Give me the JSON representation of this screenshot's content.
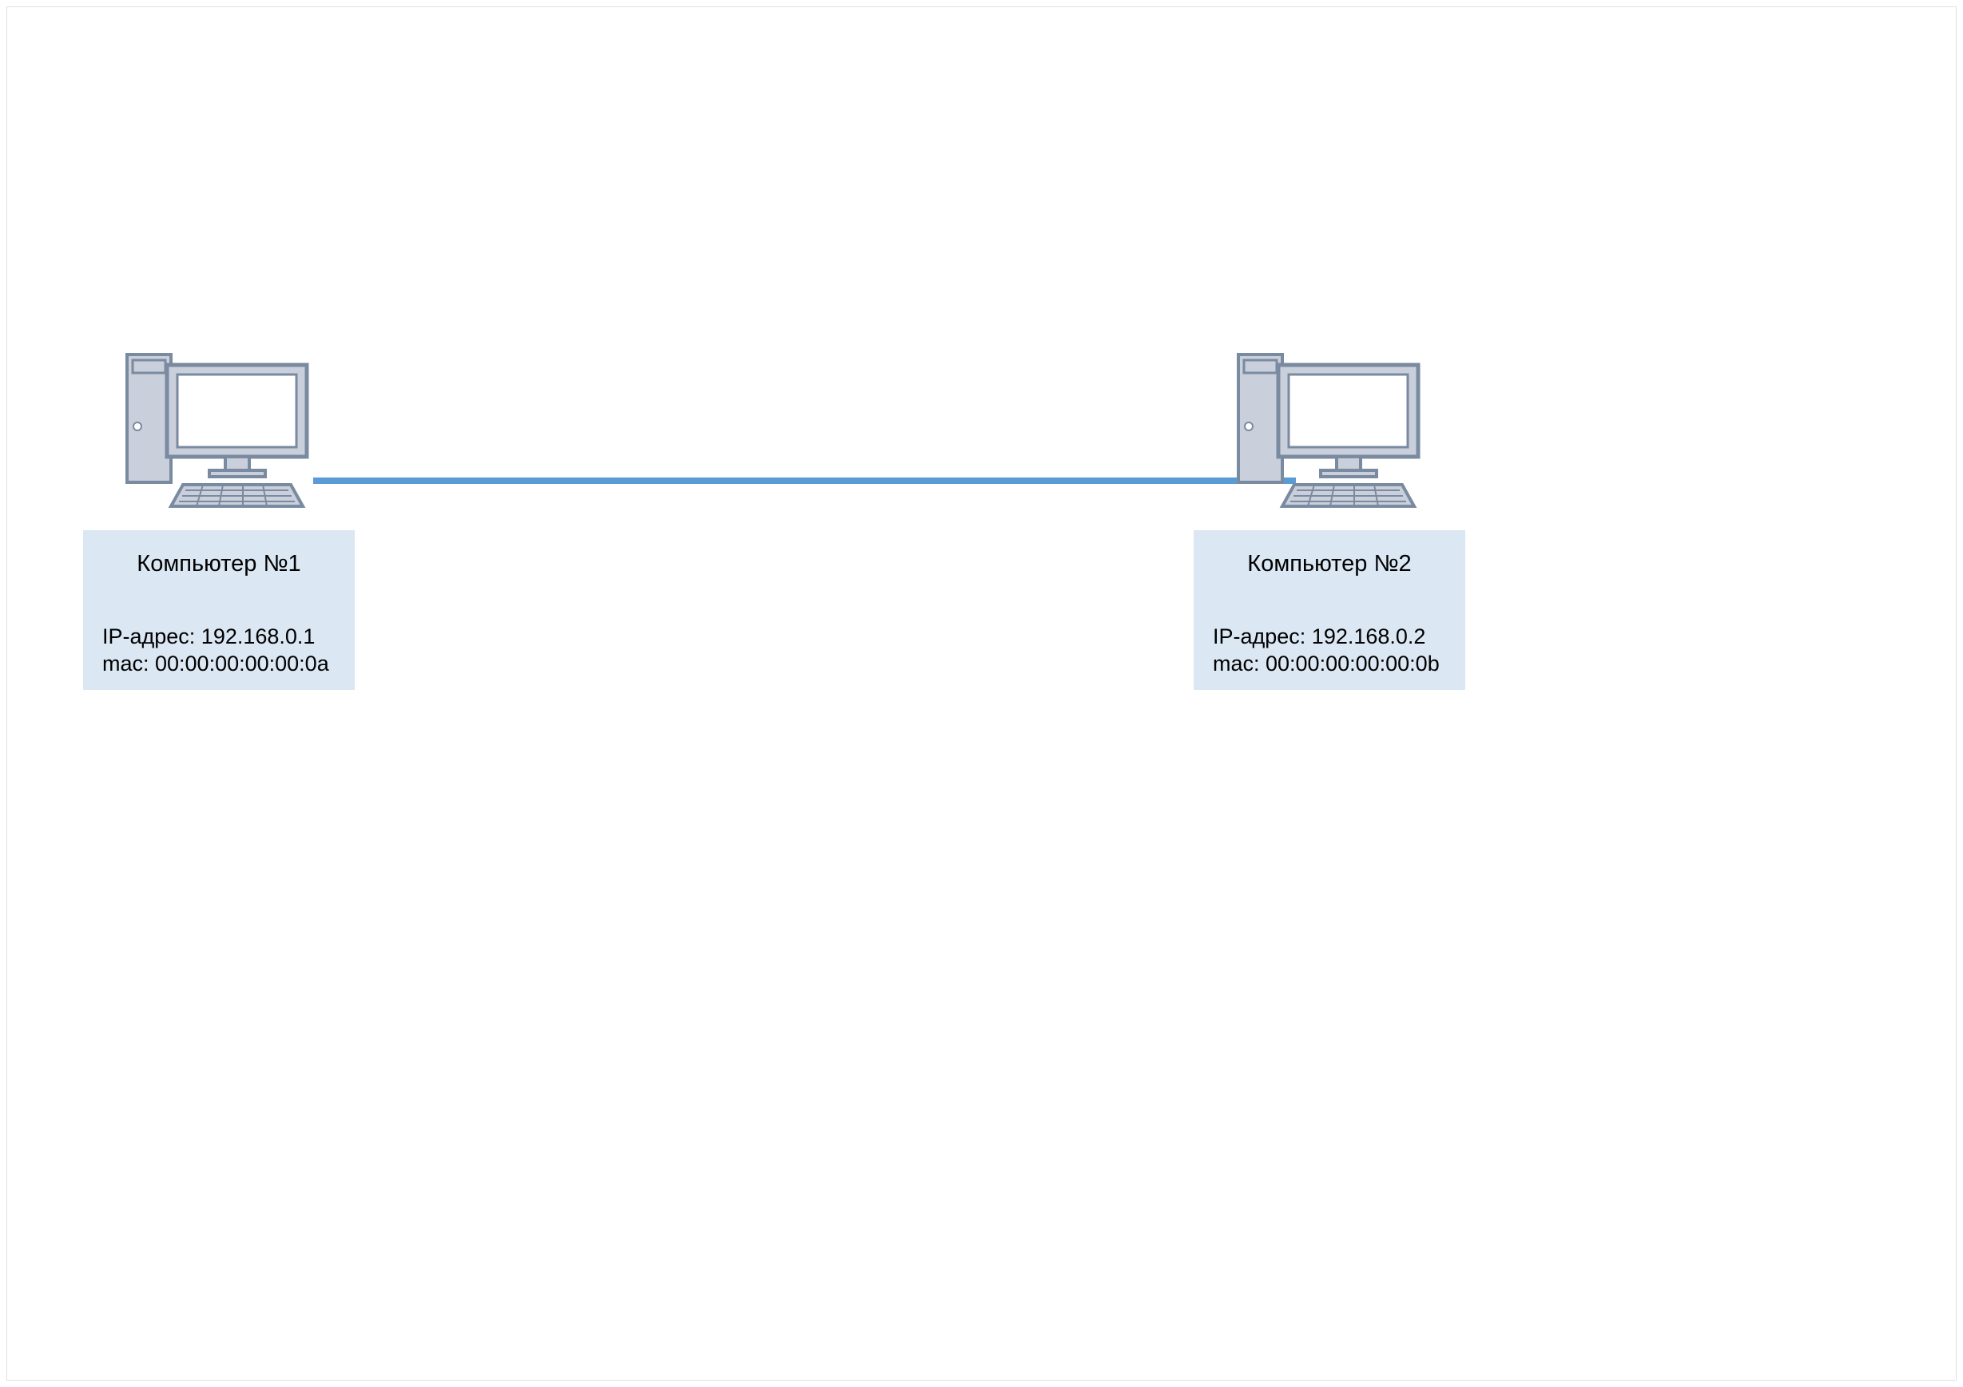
{
  "nodes": {
    "pc1": {
      "title": "Компьютер №1",
      "ip_line": "IP-адрес: 192.168.0.1",
      "mac_line": "mac: 00:00:00:00:00:0a"
    },
    "pc2": {
      "title": "Компьютер №2",
      "ip_line": "IP-адрес: 192.168.0.2",
      "mac_line": "mac: 00:00:00:00:00:0b"
    }
  },
  "link": {
    "from": "pc1",
    "to": "pc2"
  },
  "colors": {
    "link": "#5b9bd5",
    "box_bg": "#dbe7f3",
    "shape_stroke": "#7a8aa0",
    "shape_fill": "#c9d0db",
    "screen_fill": "#ffffff"
  }
}
